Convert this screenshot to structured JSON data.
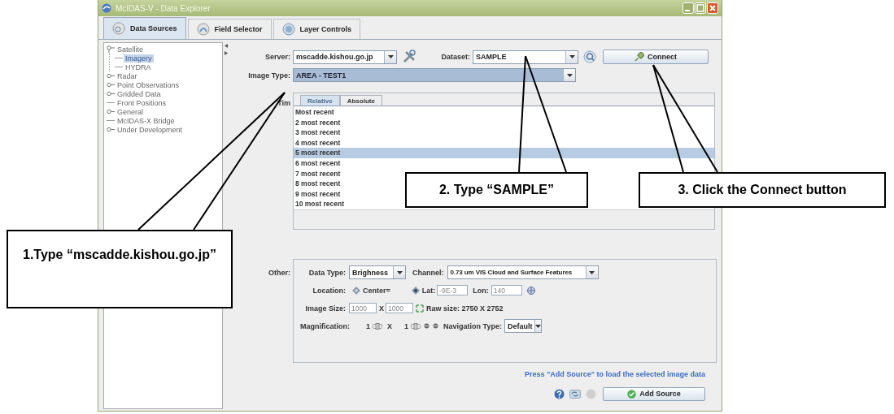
{
  "window": {
    "title": "McIDAS-V - Data Explorer"
  },
  "tabs": [
    {
      "label": "Data Sources",
      "selected": true
    },
    {
      "label": "Field Selector",
      "selected": false
    },
    {
      "label": "Layer Controls",
      "selected": false
    }
  ],
  "tree": [
    {
      "label": "Satellite",
      "kind": "folder",
      "expanded": true,
      "selected": false,
      "children": [
        {
          "label": "Imagery",
          "kind": "leaf",
          "selected": true
        },
        {
          "label": "HYDRA",
          "kind": "leaf",
          "selected": false
        }
      ]
    },
    {
      "label": "Radar",
      "kind": "folder",
      "expanded": false,
      "selected": false
    },
    {
      "label": "Point Observations",
      "kind": "folder",
      "expanded": false,
      "selected": false
    },
    {
      "label": "Gridded Data",
      "kind": "folder",
      "expanded": false,
      "selected": false
    },
    {
      "label": "Front Positions",
      "kind": "leaf",
      "selected": false
    },
    {
      "label": "General",
      "kind": "folder",
      "expanded": false,
      "selected": false
    },
    {
      "label": "McIDAS-X Bridge",
      "kind": "leaf",
      "selected": false
    },
    {
      "label": "Under Development",
      "kind": "folder",
      "expanded": false,
      "selected": false
    }
  ],
  "chooser": {
    "server": {
      "label": "Server:",
      "value": "mscadde.kishou.go.jp"
    },
    "dataset": {
      "label": "Dataset:",
      "value": "SAMPLE"
    },
    "connect_button": "Connect",
    "image_type": {
      "label": "Image Type:",
      "value": "AREA - TEST1"
    },
    "times": {
      "label": "Tim",
      "tabs": [
        {
          "label": "Relative",
          "selected": true
        },
        {
          "label": "Absolute",
          "selected": false
        }
      ],
      "items": [
        {
          "label": "Most recent",
          "selected": false
        },
        {
          "label": "2 most recent",
          "selected": false
        },
        {
          "label": "3 most recent",
          "selected": false
        },
        {
          "label": "4 most recent",
          "selected": false
        },
        {
          "label": "5 most recent",
          "selected": true
        },
        {
          "label": "6 most recent",
          "selected": false
        },
        {
          "label": "7 most recent",
          "selected": false
        },
        {
          "label": "8 most recent",
          "selected": false
        },
        {
          "label": "9 most recent",
          "selected": false
        },
        {
          "label": "10 most recent",
          "selected": false
        }
      ]
    }
  },
  "other": {
    "label": "Other:",
    "data_type": {
      "label": "Data Type:",
      "value": "Brighness"
    },
    "channel": {
      "label": "Channel:",
      "value": "0.73 um VIS Cloud and Surface Features"
    },
    "location": {
      "label": "Location:",
      "options": [
        {
          "label": "Center=",
          "selected": false
        },
        {
          "label": "Lat:",
          "selected": true
        }
      ],
      "lat": "-9E-3",
      "lon_label": "Lon:",
      "lon": "140"
    },
    "image_size": {
      "label": "Image Size:",
      "lines": "1000",
      "times": "X",
      "elements": "1000",
      "raw_size": "Raw size: 2750 X 2752"
    },
    "magnification": {
      "label": "Magnification:",
      "lines": "1",
      "times": "X",
      "elements": "1"
    },
    "navigation_type": {
      "label": "Navigation Type:",
      "value": "Default"
    }
  },
  "status": "Press \"Add Source\" to load the selected image data",
  "add_source_button": "Add Source",
  "callouts": [
    {
      "text": "1.Type “mscadde.kishou.go.jp”"
    },
    {
      "text": "2. Type “SAMPLE”"
    },
    {
      "text": "3. Click the Connect button"
    }
  ]
}
